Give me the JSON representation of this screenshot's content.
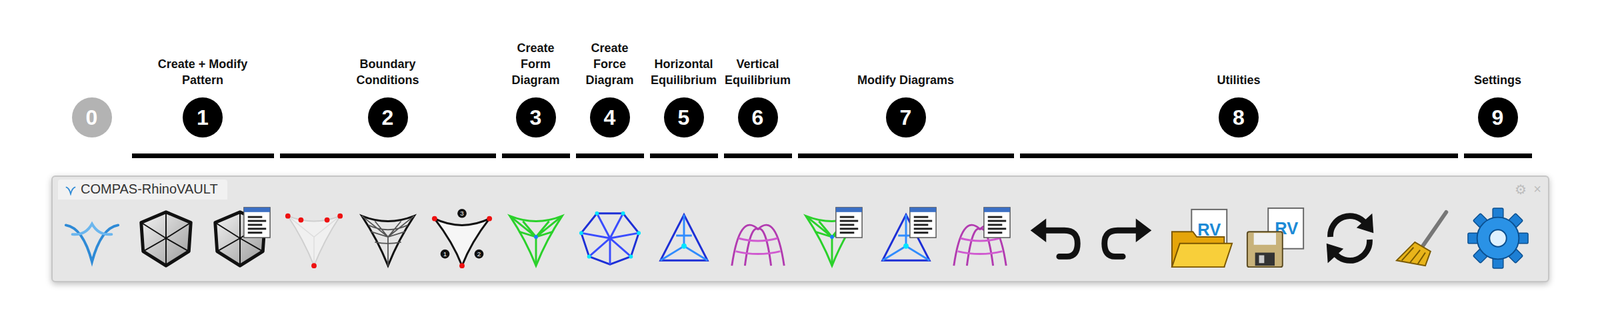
{
  "window": {
    "title": "COMPAS-RhinoVAULT",
    "controls": [
      "⚙",
      "×"
    ]
  },
  "groups": [
    {
      "number": "0",
      "label": [],
      "dimmed": true,
      "tools": [
        {
          "kind": "logo"
        }
      ]
    },
    {
      "number": "1",
      "label": [
        "Create + Modify",
        "Pattern"
      ],
      "dimmed": false,
      "tools": [
        {
          "kind": "pattern"
        },
        {
          "kind": "pattern-edit"
        }
      ]
    },
    {
      "number": "2",
      "label": [
        "Boundary",
        "Conditions"
      ],
      "dimmed": false,
      "tools": [
        {
          "kind": "supports"
        },
        {
          "kind": "openings"
        },
        {
          "kind": "edges",
          "marks": [
            "3",
            "1",
            "2"
          ]
        }
      ]
    },
    {
      "number": "3",
      "label": [
        "Create",
        "Form",
        "Diagram"
      ],
      "dimmed": false,
      "tools": [
        {
          "kind": "form"
        }
      ]
    },
    {
      "number": "4",
      "label": [
        "Create",
        "Force",
        "Diagram"
      ],
      "dimmed": false,
      "tools": [
        {
          "kind": "force"
        }
      ]
    },
    {
      "number": "5",
      "label": [
        "Horizontal",
        "Equilibrium"
      ],
      "dimmed": false,
      "tools": [
        {
          "kind": "horizontal"
        }
      ]
    },
    {
      "number": "6",
      "label": [
        "Vertical",
        "Equilibrium"
      ],
      "dimmed": false,
      "tools": [
        {
          "kind": "vertical"
        }
      ]
    },
    {
      "number": "7",
      "label": [
        "Modify Diagrams"
      ],
      "dimmed": false,
      "tools": [
        {
          "kind": "form-edit"
        },
        {
          "kind": "force-edit"
        },
        {
          "kind": "thrust-edit"
        }
      ]
    },
    {
      "number": "8",
      "label": [
        "Utilities"
      ],
      "dimmed": false,
      "tools": [
        {
          "kind": "undo"
        },
        {
          "kind": "redo"
        },
        {
          "kind": "open",
          "badge": "RV"
        },
        {
          "kind": "save",
          "badge": "RV"
        },
        {
          "kind": "reload"
        },
        {
          "kind": "clear"
        }
      ]
    },
    {
      "number": "9",
      "label": [
        "Settings"
      ],
      "dimmed": false,
      "tools": [
        {
          "kind": "settings"
        }
      ]
    }
  ]
}
